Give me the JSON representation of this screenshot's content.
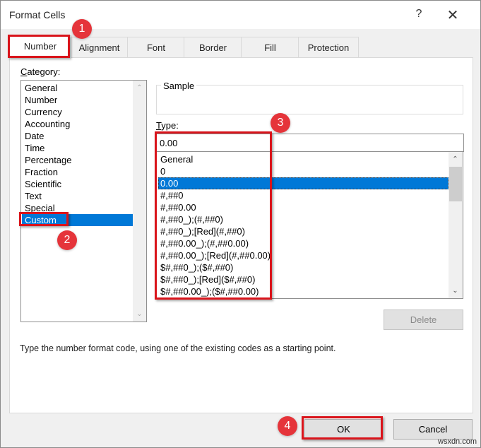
{
  "window": {
    "title": "Format Cells",
    "help_glyph": "?",
    "close_glyph": "✕"
  },
  "tabs": [
    {
      "label": "Number",
      "active": true
    },
    {
      "label": "Alignment",
      "active": false
    },
    {
      "label": "Font",
      "active": false
    },
    {
      "label": "Border",
      "active": false
    },
    {
      "label": "Fill",
      "active": false
    },
    {
      "label": "Protection",
      "active": false
    }
  ],
  "category": {
    "label_accel": "C",
    "label_rest": "ategory:",
    "items": [
      "General",
      "Number",
      "Currency",
      "Accounting",
      "Date",
      "Time",
      "Percentage",
      "Fraction",
      "Scientific",
      "Text",
      "Special",
      "Custom"
    ],
    "selected": "Custom"
  },
  "sample": {
    "label": "Sample",
    "value": ""
  },
  "type": {
    "label_accel": "T",
    "label_rest": "ype:",
    "value": "0.00",
    "items": [
      "General",
      "0",
      "0.00",
      "#,##0",
      "#,##0.00",
      "#,##0_);(#,##0)",
      "#,##0_);[Red](#,##0)",
      "#,##0.00_);(#,##0.00)",
      "#,##0.00_);[Red](#,##0.00)",
      "$#,##0_);($#,##0)",
      "$#,##0_);[Red]($#,##0)",
      "$#,##0.00_);($#,##0.00)"
    ],
    "selected": "0.00"
  },
  "buttons": {
    "delete": "Delete",
    "ok": "OK",
    "cancel": "Cancel"
  },
  "hint": "Type the number format code, using one of the existing codes as a starting point.",
  "scroll_arrows": {
    "up": "⌃",
    "down": "⌄"
  },
  "annotations": {
    "badges": [
      "1",
      "2",
      "3",
      "4"
    ],
    "highlight_color": "#d9141b",
    "badge_color": "#e5343a"
  },
  "watermark": "wsxdn.com"
}
